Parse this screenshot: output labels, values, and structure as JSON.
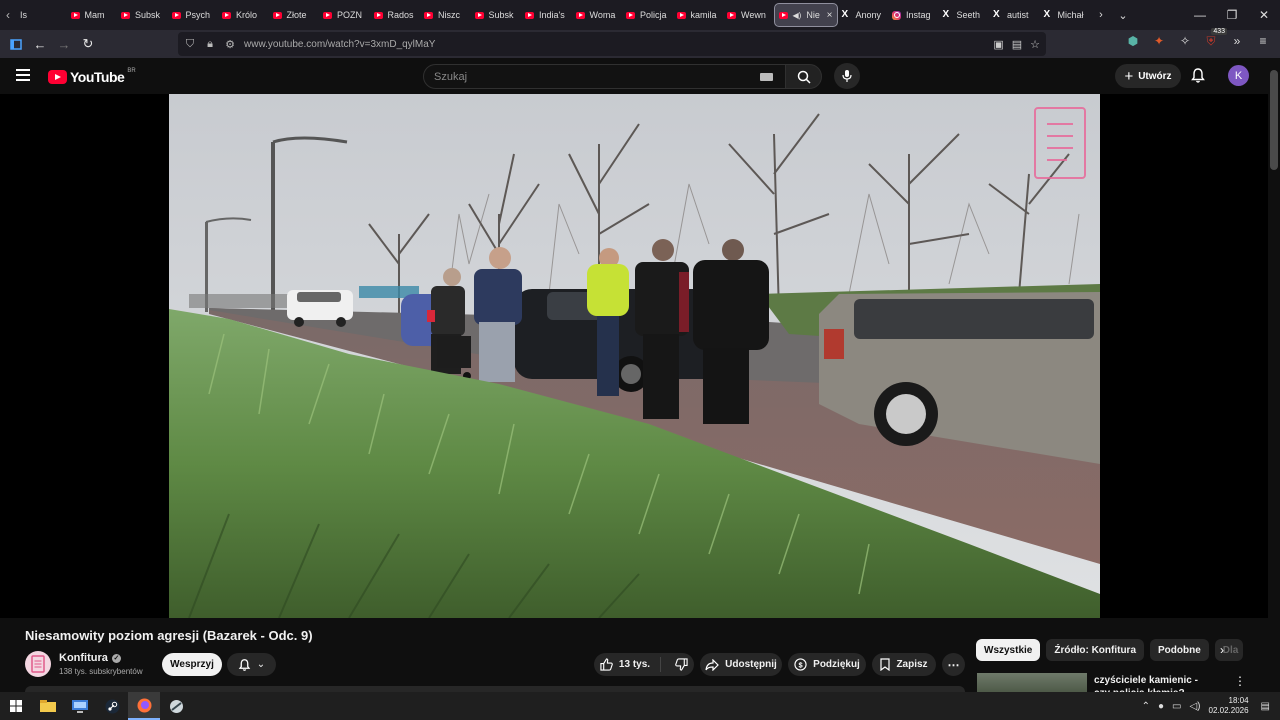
{
  "browser": {
    "tabs": [
      {
        "label": "Is",
        "icon": "none"
      },
      {
        "label": "Mam",
        "icon": "youtube"
      },
      {
        "label": "Subsk",
        "icon": "youtube"
      },
      {
        "label": "Psych",
        "icon": "youtube"
      },
      {
        "label": "Królo",
        "icon": "youtube"
      },
      {
        "label": "Złote",
        "icon": "youtube"
      },
      {
        "label": "POZN",
        "icon": "youtube"
      },
      {
        "label": "Rados",
        "icon": "youtube"
      },
      {
        "label": "Niszc",
        "icon": "youtube"
      },
      {
        "label": "Subsk",
        "icon": "youtube"
      },
      {
        "label": "India's",
        "icon": "youtube"
      },
      {
        "label": "Woma",
        "icon": "youtube"
      },
      {
        "label": "Policja",
        "icon": "youtube"
      },
      {
        "label": "kamila",
        "icon": "youtube"
      },
      {
        "label": "Wewn",
        "icon": "youtube"
      }
    ],
    "active_tab": {
      "label": "Nie",
      "close": "×"
    },
    "tabs_after": [
      {
        "label": "Anony",
        "icon": "x"
      },
      {
        "label": "Instag",
        "icon": "instagram"
      },
      {
        "label": "Seeth",
        "icon": "x"
      },
      {
        "label": "autist",
        "icon": "x"
      },
      {
        "label": "Michał",
        "icon": "x"
      }
    ],
    "url": "www.youtube.com/watch?v=3xmD_qylMaY",
    "extension_badge": "433"
  },
  "youtube": {
    "logo_text": "YouTube",
    "country_code": "BR",
    "search_placeholder": "Szukaj",
    "create_label": "Utwórz",
    "avatar_letter": "K"
  },
  "video": {
    "title": "Niesamowity poziom agresji (Bazarek - Odc. 9)",
    "channel": "Konfitura",
    "subscribers": "138 tys. subskrybentów",
    "support_label": "Wesprzyj",
    "likes": "13 tys.",
    "share_label": "Udostępnij",
    "thanks_label": "Podziękuj",
    "save_label": "Zapisz"
  },
  "chips": [
    "Wszystkie",
    "Źródło: Konfitura",
    "Podobne",
    "Dla"
  ],
  "related": {
    "title": "czyściciele kamienic - czy policja kłamie?"
  },
  "taskbar": {
    "time": "18:04",
    "date": "02.02.2026"
  },
  "colors": {
    "yt_red": "#ff0033",
    "background": "#0f0f0f",
    "avatar_purple": "#7e57c2"
  }
}
